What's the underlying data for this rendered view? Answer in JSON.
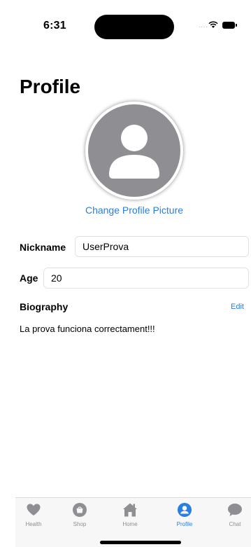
{
  "status_bar": {
    "time": "6:31",
    "signal": "...."
  },
  "page": {
    "title": "Profile"
  },
  "profile": {
    "change_picture_label": "Change Profile Picture",
    "nickname_label": "Nickname",
    "nickname_value": "UserProva",
    "age_label": "Age",
    "age_value": "20",
    "biography_label": "Biography",
    "edit_label": "Edit",
    "biography_text": "La prova funciona correctament!!!"
  },
  "tab_bar": {
    "items": [
      {
        "label": "Health",
        "icon": "heart-icon",
        "active": false
      },
      {
        "label": "Shop",
        "icon": "shopping-bag-icon",
        "active": false
      },
      {
        "label": "Home",
        "icon": "house-icon",
        "active": false
      },
      {
        "label": "Profile",
        "icon": "person-circle-icon",
        "active": true
      },
      {
        "label": "Chat",
        "icon": "chat-bubble-icon",
        "active": false
      }
    ]
  },
  "colors": {
    "accent": "#2a7de1",
    "inactive": "#8e8e93",
    "avatar_bg": "#8e8e93"
  }
}
